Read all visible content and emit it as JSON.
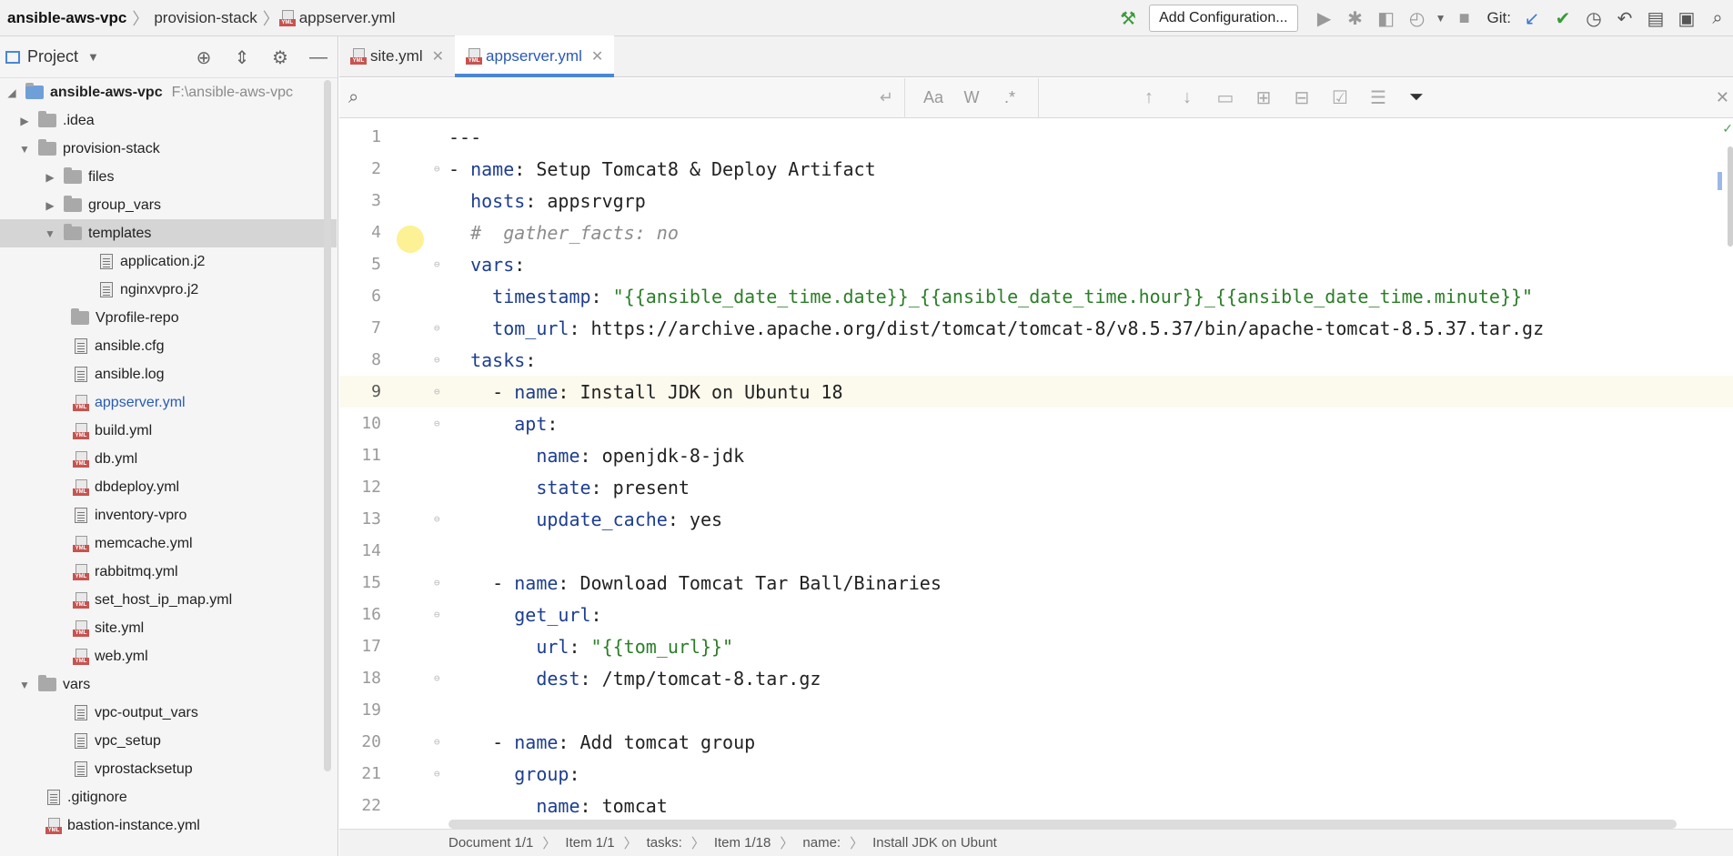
{
  "breadcrumbs": [
    "ansible-aws-vpc",
    "provision-stack",
    "appserver.yml"
  ],
  "toolbar": {
    "add_config_label": "Add Configuration...",
    "git_label": "Git:"
  },
  "sidebar": {
    "title": "Project",
    "root": {
      "name": "ansible-aws-vpc",
      "path": "F:\\ansible-aws-vpc"
    },
    "items": [
      {
        "label": ".idea"
      },
      {
        "label": "provision-stack"
      },
      {
        "label": "files"
      },
      {
        "label": "group_vars"
      },
      {
        "label": "templates"
      },
      {
        "label": "application.j2"
      },
      {
        "label": "nginxvpro.j2"
      },
      {
        "label": "Vprofile-repo"
      },
      {
        "label": "ansible.cfg"
      },
      {
        "label": "ansible.log"
      },
      {
        "label": "appserver.yml"
      },
      {
        "label": "build.yml"
      },
      {
        "label": "db.yml"
      },
      {
        "label": "dbdeploy.yml"
      },
      {
        "label": "inventory-vpro"
      },
      {
        "label": "memcache.yml"
      },
      {
        "label": "rabbitmq.yml"
      },
      {
        "label": "set_host_ip_map.yml"
      },
      {
        "label": "site.yml"
      },
      {
        "label": "web.yml"
      },
      {
        "label": "vars"
      },
      {
        "label": "vpc-output_vars"
      },
      {
        "label": "vpc_setup"
      },
      {
        "label": "vprostacksetup"
      },
      {
        "label": ".gitignore"
      },
      {
        "label": "bastion-instance.yml"
      }
    ]
  },
  "tabs": [
    {
      "label": "site.yml"
    },
    {
      "label": "appserver.yml"
    }
  ],
  "search": {
    "placeholder": "",
    "value": ""
  },
  "editor": {
    "lines": [
      {
        "n": "1",
        "parts": [
          [
            "t",
            "---"
          ]
        ]
      },
      {
        "n": "2",
        "parts": [
          [
            "t",
            "- "
          ],
          [
            "k",
            "name"
          ],
          [
            "t",
            ": Setup Tomcat8 & Deploy Artifact"
          ]
        ]
      },
      {
        "n": "3",
        "parts": [
          [
            "t",
            "  "
          ],
          [
            "k",
            "hosts"
          ],
          [
            "t",
            ": appsrvgrp"
          ]
        ]
      },
      {
        "n": "4",
        "parts": [
          [
            "t",
            "  "
          ],
          [
            "c",
            "#  gather_facts: no"
          ]
        ]
      },
      {
        "n": "5",
        "parts": [
          [
            "t",
            "  "
          ],
          [
            "k",
            "vars"
          ],
          [
            "t",
            ":"
          ]
        ]
      },
      {
        "n": "6",
        "parts": [
          [
            "t",
            "    "
          ],
          [
            "k",
            "timestamp"
          ],
          [
            "t",
            ": "
          ],
          [
            "s",
            "\"{{ansible_date_time.date}}_{{ansible_date_time.hour}}_{{ansible_date_time.minute}}\""
          ]
        ]
      },
      {
        "n": "7",
        "parts": [
          [
            "t",
            "    "
          ],
          [
            "k",
            "tom_url"
          ],
          [
            "t",
            ": https://archive.apache.org/dist/tomcat/tomcat-8/v8.5.37/bin/apache-tomcat-8.5.37.tar.gz"
          ]
        ]
      },
      {
        "n": "8",
        "parts": [
          [
            "t",
            "  "
          ],
          [
            "k",
            "tasks"
          ],
          [
            "t",
            ":"
          ]
        ]
      },
      {
        "n": "9",
        "parts": [
          [
            "t",
            "    - "
          ],
          [
            "k",
            "name"
          ],
          [
            "t",
            ": Install JDK on Ubuntu 18"
          ]
        ]
      },
      {
        "n": "10",
        "parts": [
          [
            "t",
            "      "
          ],
          [
            "k",
            "apt"
          ],
          [
            "t",
            ":"
          ]
        ]
      },
      {
        "n": "11",
        "parts": [
          [
            "t",
            "        "
          ],
          [
            "k",
            "name"
          ],
          [
            "t",
            ": openjdk-8-jdk"
          ]
        ]
      },
      {
        "n": "12",
        "parts": [
          [
            "t",
            "        "
          ],
          [
            "k",
            "state"
          ],
          [
            "t",
            ": present"
          ]
        ]
      },
      {
        "n": "13",
        "parts": [
          [
            "t",
            "        "
          ],
          [
            "k",
            "update_cache"
          ],
          [
            "t",
            ": yes"
          ]
        ]
      },
      {
        "n": "14",
        "parts": [
          [
            "t",
            ""
          ]
        ]
      },
      {
        "n": "15",
        "parts": [
          [
            "t",
            "    - "
          ],
          [
            "k",
            "name"
          ],
          [
            "t",
            ": Download Tomcat Tar Ball/Binaries"
          ]
        ]
      },
      {
        "n": "16",
        "parts": [
          [
            "t",
            "      "
          ],
          [
            "k",
            "get_url"
          ],
          [
            "t",
            ":"
          ]
        ]
      },
      {
        "n": "17",
        "parts": [
          [
            "t",
            "        "
          ],
          [
            "k",
            "url"
          ],
          [
            "t",
            ": "
          ],
          [
            "s",
            "\"{{tom_url}}\""
          ]
        ]
      },
      {
        "n": "18",
        "parts": [
          [
            "t",
            "        "
          ],
          [
            "k",
            "dest"
          ],
          [
            "t",
            ": /tmp/tomcat-8.tar.gz"
          ]
        ]
      },
      {
        "n": "19",
        "parts": [
          [
            "t",
            ""
          ]
        ]
      },
      {
        "n": "20",
        "parts": [
          [
            "t",
            "    - "
          ],
          [
            "k",
            "name"
          ],
          [
            "t",
            ": Add tomcat group"
          ]
        ]
      },
      {
        "n": "21",
        "parts": [
          [
            "t",
            "      "
          ],
          [
            "k",
            "group"
          ],
          [
            "t",
            ":"
          ]
        ]
      },
      {
        "n": "22",
        "parts": [
          [
            "t",
            "        "
          ],
          [
            "k",
            "name"
          ],
          [
            "t",
            ": tomcat"
          ]
        ]
      }
    ]
  },
  "statusbar": [
    "Document 1/1",
    "Item 1/1",
    "tasks:",
    "Item 1/18",
    "name:",
    "Install JDK on Ubunt"
  ],
  "colors": {
    "keyword": "#1d3e8f",
    "string": "#2b7e27",
    "comment": "#8c8c8c",
    "accent": "#4a87d8"
  }
}
